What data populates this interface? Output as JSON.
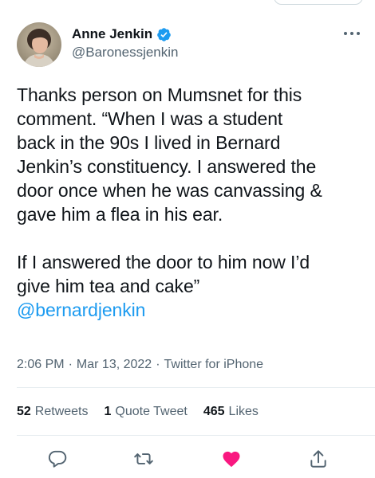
{
  "user": {
    "display_name": "Anne Jenkin",
    "handle": "@Baronessjenkin",
    "verified": true
  },
  "tweet": {
    "lines_paragraph_1": [
      "Thanks person on Mumsnet for this",
      "comment.  “When I was a student",
      "back in the 90s I lived in Bernard",
      "Jenkin’s constituency. I answered the",
      "door once when he was canvassing &",
      "gave him a flea in his ear."
    ],
    "lines_paragraph_2": [
      "If I answered the door to him now I’d",
      "give him tea and cake”"
    ],
    "mention": "@bernardjenkin"
  },
  "meta": {
    "time": "2:06 PM",
    "separator": "·",
    "date": "Mar 13, 2022",
    "source": "Twitter for iPhone"
  },
  "stats": {
    "retweets_count": "52",
    "retweets_label": "Retweets",
    "quotes_count": "1",
    "quotes_label": "Quote Tweet",
    "likes_count": "465",
    "likes_label": "Likes"
  },
  "actions": {
    "reply_icon": "reply-icon",
    "retweet_icon": "retweet-icon",
    "like_icon": "heart-icon",
    "share_icon": "share-icon",
    "liked": true
  },
  "colors": {
    "accent": "#1d9bf0",
    "like": "#f91880",
    "text_primary": "#0f1419",
    "text_secondary": "#536471"
  }
}
